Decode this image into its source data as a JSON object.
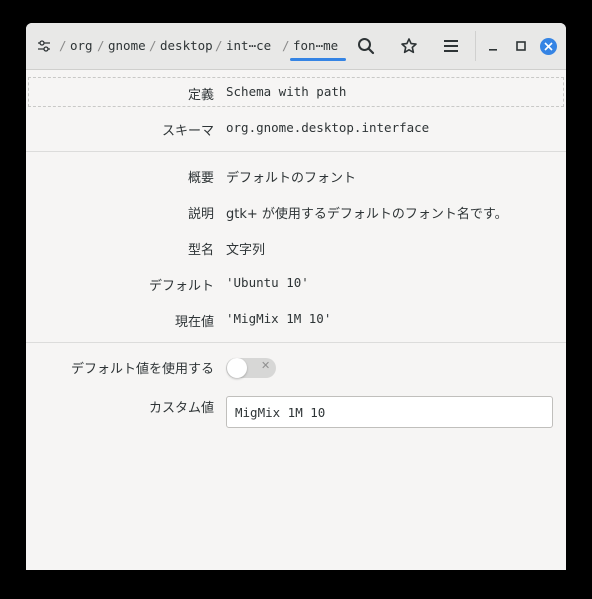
{
  "breadcrumb": {
    "items": [
      "org",
      "gnome",
      "desktop",
      "int⋯ce",
      "fon⋯me"
    ],
    "separator": "/"
  },
  "headerbar": {
    "settings_icon": "sliders-icon",
    "search_icon": "search-icon",
    "bookmark_icon": "star-icon",
    "menu_icon": "hamburger-menu-icon",
    "minimize_icon": "minimize-icon",
    "maximize_icon": "maximize-icon",
    "close_icon": "close-icon",
    "accent_color": "#3584e4"
  },
  "details": {
    "definition_label": "定義",
    "definition_value": "Schema with path",
    "schema_label": "スキーマ",
    "schema_value": "org.gnome.desktop.interface",
    "summary_label": "概要",
    "summary_value": "デフォルトのフォント",
    "description_label": "説明",
    "description_value": "gtk+ が使用するデフォルトのフォント名です。",
    "type_label": "型名",
    "type_value": "文字列",
    "default_label": "デフォルト",
    "default_value": "'Ubuntu 10'",
    "current_label": "現在値",
    "current_value": "'MigMix 1M 10'"
  },
  "edit": {
    "use_default_label": "デフォルト値を使用する",
    "use_default_on": false,
    "custom_label": "カスタム値",
    "custom_value": "MigMix 1M 10"
  }
}
